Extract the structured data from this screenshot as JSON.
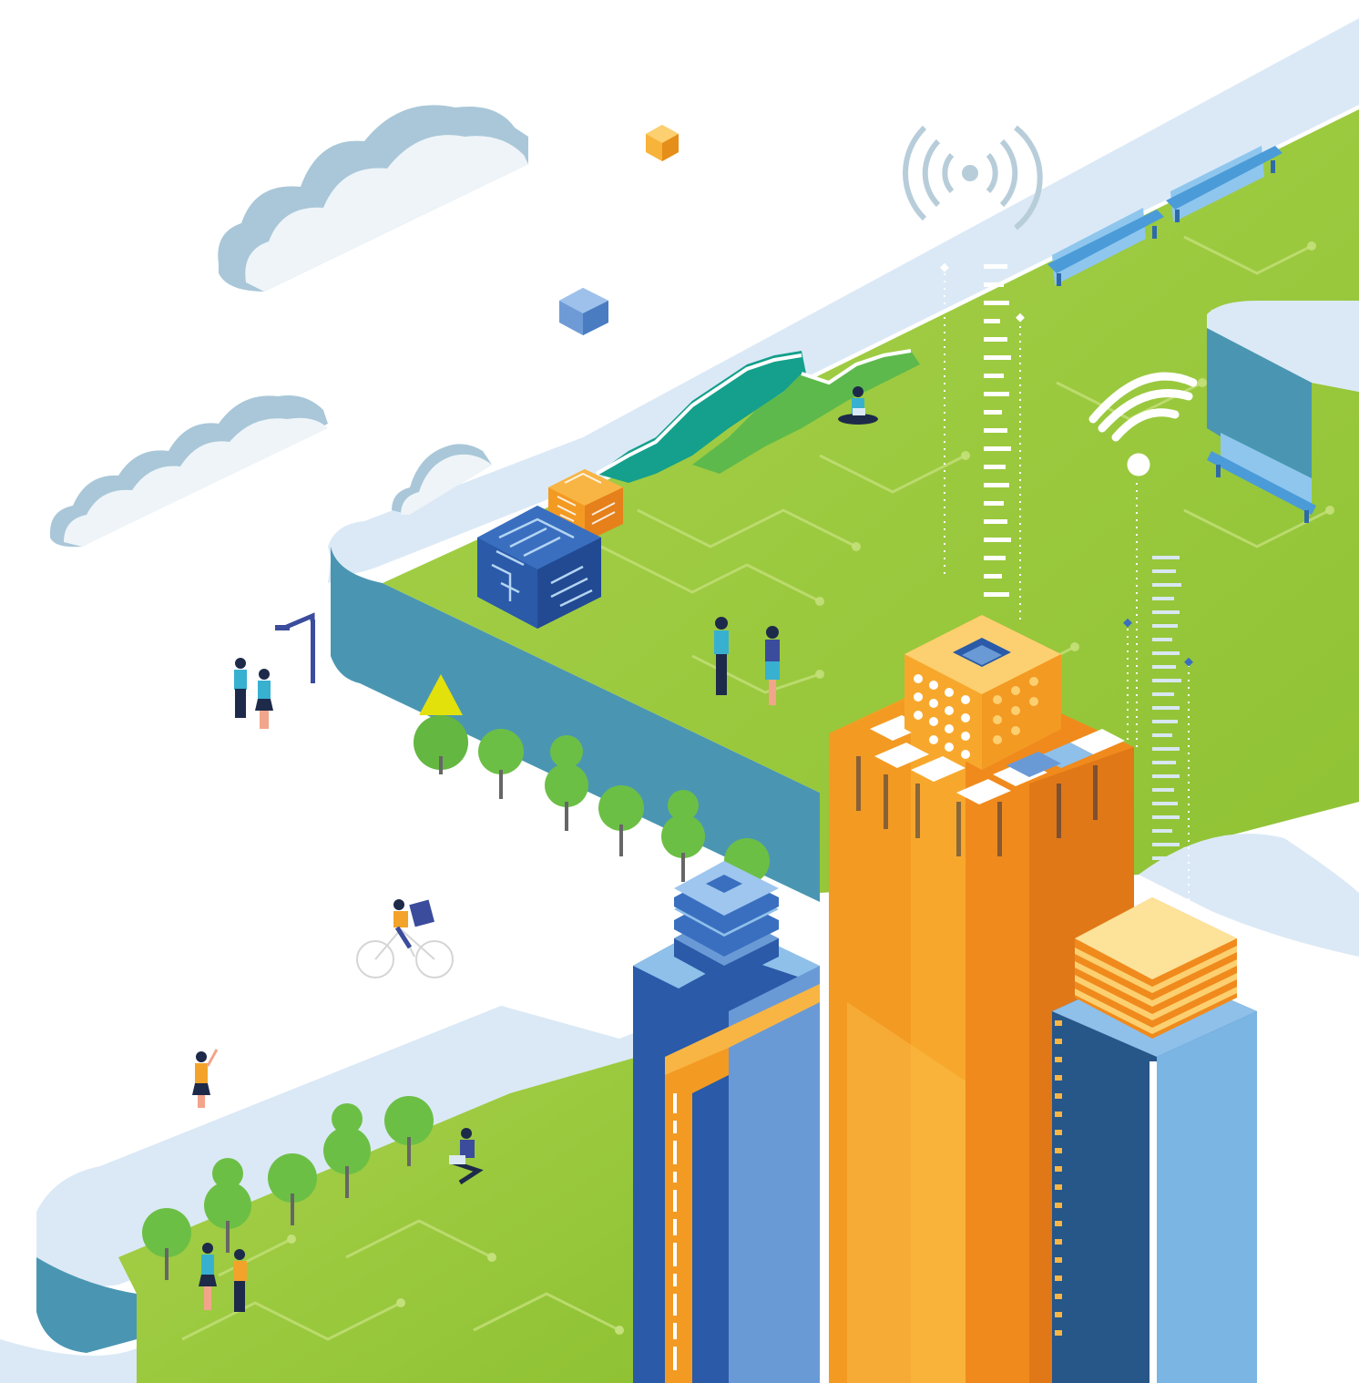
{
  "image": {
    "kind": "isometric smart-city illustration",
    "colors": {
      "sky": "#ffffff",
      "cloud_top": "#a9c7d8",
      "cloud_front": "#eef4f8",
      "ribbon_light": "#dbe9f6",
      "ribbon_wall": "#4a96b2",
      "grass": "#9ccb3b",
      "grass_dark": "#86b930",
      "hill_teal": "#14a08c",
      "hill_green": "#5db94c",
      "tower_orange": "#f39a23",
      "tower_orange_light": "#fbc04e",
      "building_blue_dark": "#2a5aa8",
      "building_blue_mid": "#6a9ad6",
      "building_blue_light": "#8ec0ea",
      "tree_green": "#6cbf45",
      "tree_dark": "#4a9e32",
      "bench_blue": "#4b9bd8",
      "signal": "#c9dbe6"
    },
    "icons": [
      "cloud-icon",
      "wifi-icon",
      "broadcast-signal-icon",
      "microchip-cube-icon",
      "tree-icon",
      "bench-icon",
      "street-lamp-icon",
      "bicycle-icon",
      "person-icon",
      "laptop-icon"
    ]
  }
}
